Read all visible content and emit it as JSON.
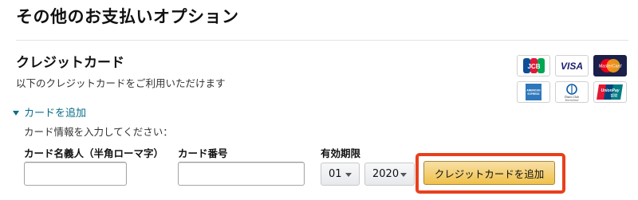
{
  "page": {
    "title": "その他のお支払いオプション"
  },
  "credit_card": {
    "title": "クレジットカード",
    "description": "以下のクレジットカードをご利用いただけます",
    "card_brands": [
      {
        "name": "JCB",
        "icon": "jcb-icon"
      },
      {
        "name": "VISA",
        "icon": "visa-icon"
      },
      {
        "name": "MasterCard",
        "icon": "mastercard-icon"
      },
      {
        "name": "AMEX",
        "icon": "amex-icon"
      },
      {
        "name": "Diners Club International",
        "icon": "diners-club-icon"
      },
      {
        "name": "UnionPay 银联",
        "icon": "unionpay-icon"
      }
    ],
    "brand_labels": {
      "jcb": "JCB",
      "visa": "VISA",
      "mastercard": "MasterCard",
      "amex": "AMERICAN EXPRESS",
      "diners": "Diners Club International",
      "unionpay": "UnionPay 银联"
    }
  },
  "add_card": {
    "toggle_label": "カードを追加",
    "instruction": "カード情報を入力してください：",
    "name_label": "カード名義人（半角ローマ字）",
    "name_value": "",
    "number_label": "カード番号",
    "number_value": "",
    "expiry_label": "有効期限",
    "expiry_month": "01",
    "expiry_year": "2020",
    "submit_label": "クレジットカードを追加"
  },
  "colors": {
    "link": "#0b6e8a",
    "button_top": "#f7dfa5",
    "button_bottom": "#f0c14b",
    "highlight_border": "#e8401c"
  }
}
